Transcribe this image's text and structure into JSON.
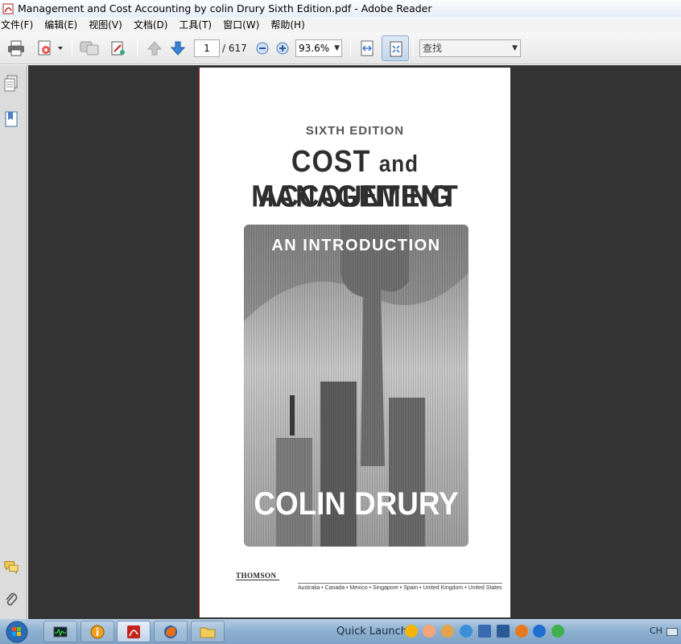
{
  "window": {
    "title": "Management and Cost Accounting by colin Drury Sixth Edition.pdf - Adobe Reader"
  },
  "menu": {
    "items": [
      {
        "label": "文件(F)"
      },
      {
        "label": "编辑(E)"
      },
      {
        "label": "视图(V)"
      },
      {
        "label": "文档(D)"
      },
      {
        "label": "工具(T)"
      },
      {
        "label": "窗口(W)"
      },
      {
        "label": "帮助(H)"
      }
    ]
  },
  "toolbar": {
    "current_page": "1",
    "page_total": "/ 617",
    "zoom": "93.6%",
    "search_placeholder": "查找",
    "icons": [
      "print-icon",
      "save-copy-icon",
      "collaborate-icon",
      "sign-icon",
      "previous-page-icon",
      "next-page-icon",
      "zoom-out-icon",
      "zoom-in-icon",
      "fit-width-icon",
      "fit-page-icon"
    ]
  },
  "leftnav": {
    "icons": [
      "pages-icon",
      "bookmarks-icon",
      "comments-icon",
      "attachments-icon"
    ]
  },
  "document": {
    "edition": "SIXTH EDITION",
    "title_line1_a": "COST",
    "title_line1_and": "and",
    "title_line1_b": "MANAGEMENT",
    "title_line2": "ACCOUNTING",
    "subtitle": "AN INTRODUCTION",
    "author": "COLIN DRURY",
    "publisher": "THOMSON",
    "countries": "Australia • Canada • Mexico • Singapore • Spain • United Kingdom • United States"
  },
  "taskbar": {
    "quick_launch_label": "Quick Launch",
    "language": "CH",
    "task_icons": [
      "task-manager-icon",
      "info-icon",
      "adobe-reader-icon",
      "firefox-icon",
      "explorer-icon"
    ]
  },
  "colors": {
    "doc_background": "#333333",
    "toolbar_active": "#c2d6ee",
    "taskbar": "#8fb1d0"
  }
}
